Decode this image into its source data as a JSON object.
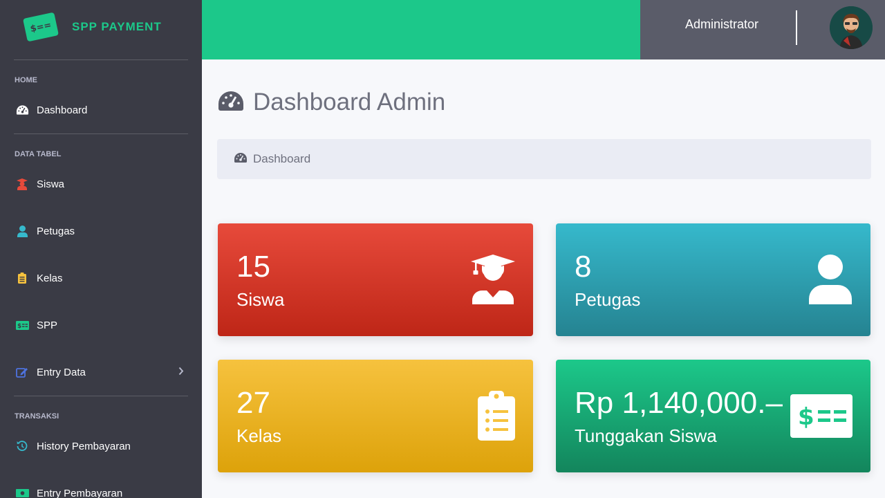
{
  "brand": {
    "name": "SPP PAYMENT",
    "logo_glyph": "$=="
  },
  "sidebar": {
    "sections": [
      {
        "heading": "HOME"
      },
      {
        "heading": "DATA TABEL"
      },
      {
        "heading": "TRANSAKSI"
      }
    ],
    "items": [
      {
        "label": "Dashboard",
        "icon": "tachometer-icon",
        "color": "#ffffff"
      },
      {
        "label": "Siswa",
        "icon": "graduate-icon",
        "color": "#e74a3b"
      },
      {
        "label": "Petugas",
        "icon": "user-icon",
        "color": "#36b9cc"
      },
      {
        "label": "Kelas",
        "icon": "clipboard-icon",
        "color": "#f6c23e"
      },
      {
        "label": "SPP",
        "icon": "money-card-icon",
        "color": "#1cc88a"
      },
      {
        "label": "Entry Data",
        "icon": "edit-icon",
        "color": "#4e73df"
      },
      {
        "label": "History Pembayaran",
        "icon": "history-icon",
        "color": "#36b9cc"
      },
      {
        "label": "Entry Pembayaran",
        "icon": "money-bill-icon",
        "color": "#1cc88a"
      }
    ]
  },
  "header": {
    "user_name": "Administrator"
  },
  "main": {
    "title": "Dashboard Admin",
    "breadcrumb": "Dashboard",
    "cards": [
      {
        "value": "15",
        "label": "Siswa",
        "icon": "graduate-icon",
        "color": "#e74a3b"
      },
      {
        "value": "8",
        "label": "Petugas",
        "icon": "user-icon",
        "color": "#36b9cc"
      },
      {
        "value": "27",
        "label": "Kelas",
        "icon": "clipboard-icon",
        "color": "#f6c23e"
      },
      {
        "value": "Rp 1,140,000.–",
        "label": "Tunggakan Siswa",
        "icon": "money-card-icon",
        "color": "#1cc88a"
      }
    ]
  }
}
